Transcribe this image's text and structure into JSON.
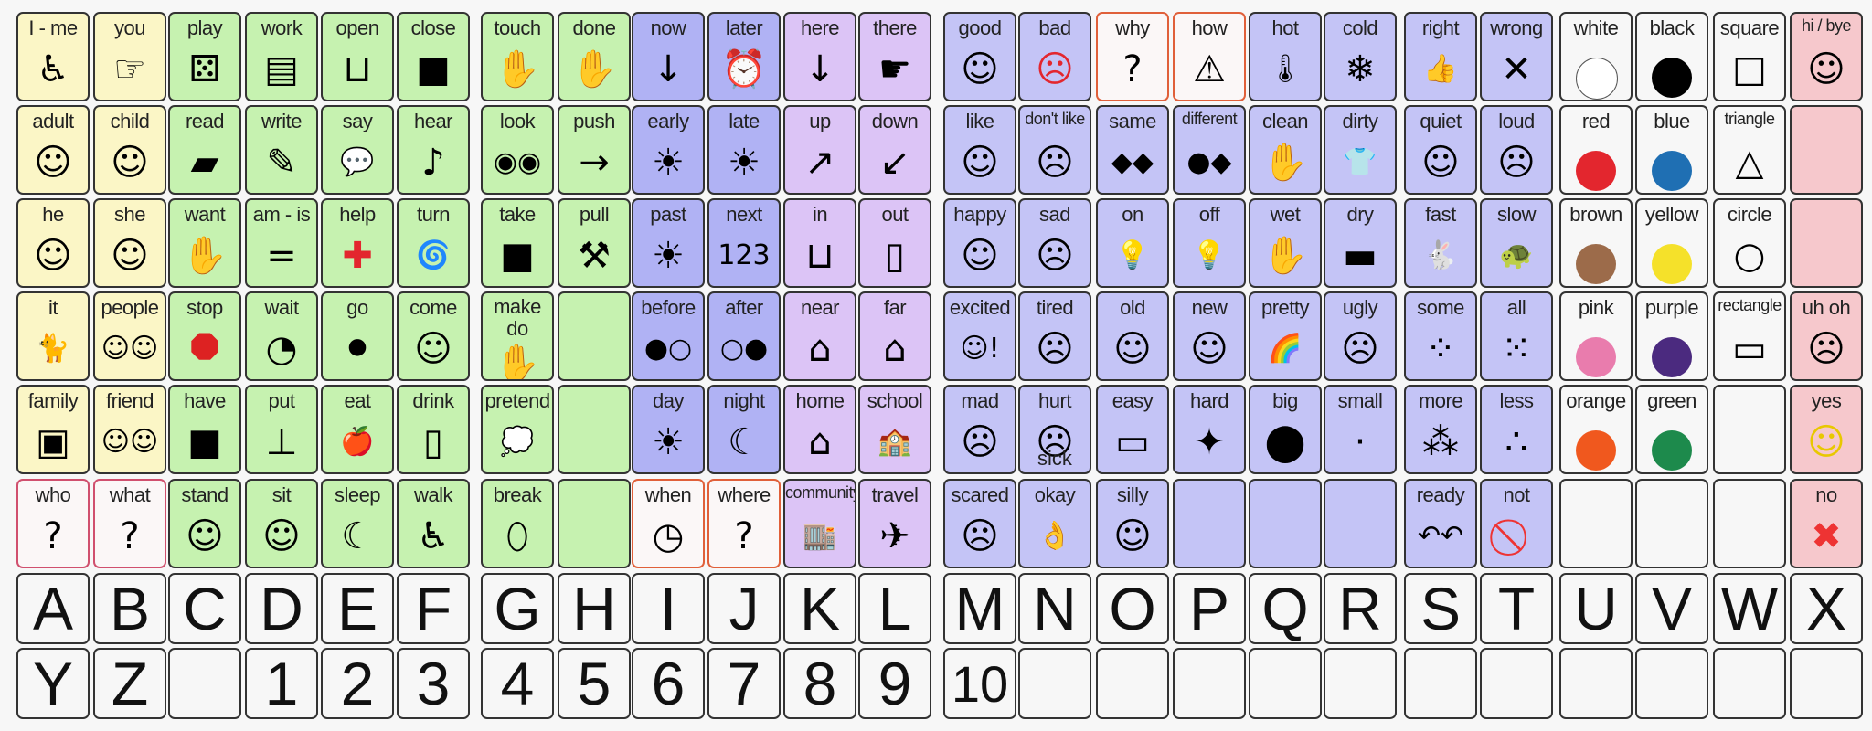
{
  "colors": {
    "Y": "#fbf6c6",
    "G": "#c6f2b0",
    "B": "#b0b2f4",
    "P": "#dcc4f6",
    "L": "#c4c4f6",
    "W": "#f7f7f7",
    "K": "#f6c8cc",
    "R": "#fbf7f7",
    "O": "#fbf7f7"
  },
  "borders": {
    "R": "#d0506e",
    "O": "#e0603a"
  },
  "rows": [
    [
      [
        "I - me",
        "Y",
        "person-wheelchair-icon",
        "♿"
      ],
      [
        "you",
        "Y",
        "pointing-hand-icon",
        "☞"
      ],
      [
        "play",
        "G",
        "board-game-icon",
        "⚄"
      ],
      [
        "work",
        "G",
        "books-icon",
        "▤"
      ],
      [
        "open",
        "G",
        "open-box-icon",
        "⊔"
      ],
      [
        "close",
        "G",
        "closed-box-icon",
        "■"
      ],
      [
        "touch",
        "G",
        "touching-hand-icon",
        "✋"
      ],
      [
        "done",
        "G",
        "done-hands-icon",
        "✋"
      ],
      [
        "now",
        "B",
        "now-arrow-icon",
        "↓"
      ],
      [
        "later",
        "B",
        "alarm-clock-icon",
        "⏰"
      ],
      [
        "here",
        "P",
        "here-arrow-icon",
        "↓"
      ],
      [
        "there",
        "P",
        "point-there-icon",
        "☛"
      ],
      [
        "good",
        "L",
        "thumbs-up-person-icon",
        "☺"
      ],
      [
        "bad",
        "L",
        "devil-icon",
        "☹"
      ],
      [
        "why",
        "O",
        "shrug-person-icon",
        "?"
      ],
      [
        "how",
        "O",
        "warning-question-icon",
        "⚠"
      ],
      [
        "hot",
        "L",
        "thermometer-icon",
        "🌡"
      ],
      [
        "cold",
        "L",
        "ice-cube-icon",
        "❄"
      ],
      [
        "right",
        "L",
        "thumbs-up-icon",
        "👍"
      ],
      [
        "wrong",
        "L",
        "x-mark-icon",
        "✕"
      ],
      [
        "white",
        "W",
        "white-circle-icon",
        "",
        "#ffffff"
      ],
      [
        "black",
        "W",
        "black-circle-icon",
        "",
        "#000000"
      ],
      [
        "square",
        "W",
        "square-icon",
        "□"
      ],
      [
        "hi / bye",
        "K",
        "waving-person-icon",
        "☺"
      ]
    ],
    [
      [
        "adult",
        "Y",
        "adult-face-icon",
        "☺"
      ],
      [
        "child",
        "Y",
        "child-face-icon",
        "☺"
      ],
      [
        "read",
        "G",
        "book-icon",
        "▰"
      ],
      [
        "write",
        "G",
        "word-icon",
        "✎"
      ],
      [
        "say",
        "G",
        "speech-bubble-icon",
        "💬"
      ],
      [
        "hear",
        "G",
        "hear-icon",
        "♪"
      ],
      [
        "look",
        "G",
        "eyes-icon",
        "◉◉"
      ],
      [
        "push",
        "G",
        "push-door-icon",
        "→"
      ],
      [
        "early",
        "B",
        "sunrise-early-icon",
        "☀"
      ],
      [
        "late",
        "B",
        "sunset-late-icon",
        "☀"
      ],
      [
        "up",
        "P",
        "up-ramp-icon",
        "↗"
      ],
      [
        "down",
        "P",
        "down-stairs-icon",
        "↙"
      ],
      [
        "like",
        "L",
        "smile-face-icon",
        "☺"
      ],
      [
        "don't like",
        "L",
        "upset-person-icon",
        "☹"
      ],
      [
        "same",
        "L",
        "same-diamonds-icon",
        "◆◆"
      ],
      [
        "different",
        "L",
        "different-shapes-icon",
        "●◆"
      ],
      [
        "clean",
        "L",
        "cleaning-hand-icon",
        "✋"
      ],
      [
        "dirty",
        "L",
        "dirty-shirt-icon",
        "👕"
      ],
      [
        "quiet",
        "L",
        "quiet-face-icon",
        "☺"
      ],
      [
        "loud",
        "L",
        "covering-ears-icon",
        "☹"
      ],
      [
        "red",
        "W",
        "red-circle-icon",
        "",
        "#e3262e"
      ],
      [
        "blue",
        "W",
        "blue-circle-icon",
        "",
        "#1f6fb3"
      ],
      [
        "triangle",
        "W",
        "triangle-icon",
        "△"
      ],
      [
        "",
        "K",
        "",
        ""
      ]
    ],
    [
      [
        "he",
        "Y",
        "boy-face-icon",
        "☺"
      ],
      [
        "she",
        "Y",
        "girl-face-icon",
        "☺"
      ],
      [
        "want",
        "G",
        "want-hands-icon",
        "✋"
      ],
      [
        "am - is",
        "G",
        "equals-icon",
        "="
      ],
      [
        "help",
        "G",
        "red-cross-icon",
        "✚"
      ],
      [
        "turn",
        "G",
        "spiral-icon",
        "🌀"
      ],
      [
        "take",
        "G",
        "take-hands-icon",
        "■"
      ],
      [
        "pull",
        "G",
        "pulling-person-icon",
        "⚒"
      ],
      [
        "past",
        "B",
        "past-sun-icon",
        "☀"
      ],
      [
        "next",
        "B",
        "next-123-icon",
        "123"
      ],
      [
        "in",
        "P",
        "in-box-icon",
        "⊔"
      ],
      [
        "out",
        "P",
        "out-door-icon",
        "▯"
      ],
      [
        "happy",
        "L",
        "happy-face-icon",
        "☺"
      ],
      [
        "sad",
        "L",
        "sad-person-icon",
        "☹"
      ],
      [
        "on",
        "L",
        "light-bulb-on-icon",
        "💡"
      ],
      [
        "off",
        "L",
        "light-bulb-off-icon",
        "💡"
      ],
      [
        "wet",
        "L",
        "wet-hands-icon",
        "✋"
      ],
      [
        "dry",
        "L",
        "towel-icon",
        "▬"
      ],
      [
        "fast",
        "L",
        "rabbit-icon",
        "🐇"
      ],
      [
        "slow",
        "L",
        "turtle-icon",
        "🐢"
      ],
      [
        "brown",
        "W",
        "brown-circle-icon",
        "",
        "#9c6b4a"
      ],
      [
        "yellow",
        "W",
        "yellow-circle-icon",
        "",
        "#f5e12a"
      ],
      [
        "circle",
        "W",
        "circle-icon",
        "○"
      ],
      [
        "",
        "K",
        "",
        ""
      ]
    ],
    [
      [
        "it",
        "Y",
        "cat-icon",
        "🐈"
      ],
      [
        "people",
        "Y",
        "people-icon",
        "☺☺"
      ],
      [
        "stop",
        "G",
        "stop-sign-icon",
        "⯃"
      ],
      [
        "wait",
        "G",
        "timer-icon",
        "◔"
      ],
      [
        "go",
        "G",
        "traffic-light-icon",
        "⚫"
      ],
      [
        "come",
        "G",
        "beckoning-person-icon",
        "☺"
      ],
      [
        "make\ndo",
        "G",
        "making-hand-icon",
        "✋"
      ],
      [
        "",
        "G",
        "",
        ""
      ],
      [
        "before",
        "B",
        "before-dots-icon",
        "●○"
      ],
      [
        "after",
        "B",
        "after-dots-icon",
        "○●"
      ],
      [
        "near",
        "P",
        "house-near-icon",
        "⌂"
      ],
      [
        "far",
        "P",
        "far-road-icon",
        "⌂"
      ],
      [
        "excited",
        "L",
        "excited-face-icon",
        "☺!"
      ],
      [
        "tired",
        "L",
        "tired-person-icon",
        "☹"
      ],
      [
        "old",
        "L",
        "old-man-icon",
        "☺"
      ],
      [
        "new",
        "L",
        "new-person-icon",
        "☺"
      ],
      [
        "pretty",
        "L",
        "rainbow-icon",
        "🌈"
      ],
      [
        "ugly",
        "L",
        "ugly-face-icon",
        "☹"
      ],
      [
        "some",
        "L",
        "some-dots-icon",
        "⁘"
      ],
      [
        "all",
        "L",
        "all-dots-icon",
        "⁙"
      ],
      [
        "pink",
        "W",
        "pink-circle-icon",
        "",
        "#e97cad"
      ],
      [
        "purple",
        "W",
        "purple-circle-icon",
        "",
        "#4b2a7f"
      ],
      [
        "rectangle",
        "W",
        "rectangle-icon",
        "▭"
      ],
      [
        "uh oh",
        "K",
        "uh-oh-face-icon",
        "☹"
      ]
    ],
    [
      [
        "family",
        "Y",
        "family-photo-icon",
        "▣"
      ],
      [
        "friend",
        "Y",
        "friends-icon",
        "☺☺"
      ],
      [
        "have",
        "G",
        "have-hand-icon",
        "■"
      ],
      [
        "put",
        "G",
        "put-cup-icon",
        "⊥"
      ],
      [
        "eat",
        "G",
        "eating-icon",
        "🍎"
      ],
      [
        "drink",
        "G",
        "glass-icon",
        "▯"
      ],
      [
        "pretend",
        "G",
        "thought-bubble-icon",
        "💭"
      ],
      [
        "",
        "G",
        "",
        ""
      ],
      [
        "day",
        "B",
        "sun-tree-icon",
        "☀"
      ],
      [
        "night",
        "B",
        "moon-stars-icon",
        "☾"
      ],
      [
        "home",
        "P",
        "home-icon",
        "⌂"
      ],
      [
        "school",
        "P",
        "school-icon",
        "🏫"
      ],
      [
        "mad",
        "L",
        "mad-face-icon",
        "☹"
      ],
      [
        "hurt",
        "L",
        "hurt-person-icon",
        "☹",
        "",
        "sick"
      ],
      [
        "easy",
        "L",
        "easy-puzzle-icon",
        "▭"
      ],
      [
        "hard",
        "L",
        "hard-puzzle-icon",
        "✦"
      ],
      [
        "big",
        "L",
        "big-blob-icon",
        "⬤"
      ],
      [
        "small",
        "L",
        "small-dot-icon",
        "·"
      ],
      [
        "more",
        "L",
        "more-pile-icon",
        "⁂"
      ],
      [
        "less",
        "L",
        "less-pile-icon",
        "∴"
      ],
      [
        "orange",
        "W",
        "orange-circle-icon",
        "",
        "#f0581e"
      ],
      [
        "green",
        "W",
        "green-circle-icon",
        "",
        "#1d8a4c"
      ],
      [
        "",
        "W",
        "",
        ""
      ],
      [
        "yes",
        "K",
        "yes-smiley-icon",
        "☺"
      ]
    ],
    [
      [
        "who",
        "R",
        "question-head-icon",
        "?"
      ],
      [
        "what",
        "R",
        "question-box-icon",
        "?"
      ],
      [
        "stand",
        "G",
        "standing-person-icon",
        "☺"
      ],
      [
        "sit",
        "G",
        "sitting-person-icon",
        "☺"
      ],
      [
        "sleep",
        "G",
        "sleeping-person-icon",
        "☾"
      ],
      [
        "walk",
        "G",
        "walking-person-icon",
        "♿"
      ],
      [
        "break",
        "G",
        "broken-egg-icon",
        "⬯"
      ],
      [
        "",
        "G",
        "",
        ""
      ],
      [
        "when",
        "O",
        "question-clock-icon",
        "◷"
      ],
      [
        "where",
        "O",
        "question-path-icon",
        "?"
      ],
      [
        "community",
        "P",
        "community-building-icon",
        "🏬"
      ],
      [
        "travel",
        "P",
        "travel-vehicles-icon",
        "✈"
      ],
      [
        "scared",
        "L",
        "scared-monster-icon",
        "☹"
      ],
      [
        "okay",
        "L",
        "ok-hand-icon",
        "👌"
      ],
      [
        "silly",
        "L",
        "silly-girl-icon",
        "☺"
      ],
      [
        "",
        "L",
        "",
        ""
      ],
      [
        "",
        "L",
        "",
        ""
      ],
      [
        "",
        "L",
        "",
        ""
      ],
      [
        "ready",
        "L",
        "ready-arrows-icon",
        "↶↶"
      ],
      [
        "not",
        "L",
        "no-sign-icon",
        "⃠"
      ],
      [
        "",
        "W",
        "",
        ""
      ],
      [
        "",
        "W",
        "",
        ""
      ],
      [
        "",
        "W",
        "",
        ""
      ],
      [
        "no",
        "K",
        "no-x-icon",
        "✖"
      ]
    ]
  ],
  "letters": [
    [
      "A",
      "B",
      "C",
      "D",
      "E",
      "F",
      "G",
      "H",
      "I",
      "J",
      "K",
      "L",
      "M",
      "N",
      "O",
      "P",
      "Q",
      "R",
      "S",
      "T",
      "U",
      "V",
      "W",
      "X"
    ],
    [
      "Y",
      "Z",
      "",
      "1",
      "2",
      "3",
      "4",
      "5",
      "6",
      "7",
      "8",
      "9",
      "10",
      "",
      "",
      "",
      "",
      "",
      "",
      "",
      "",
      "",
      "",
      ""
    ]
  ]
}
